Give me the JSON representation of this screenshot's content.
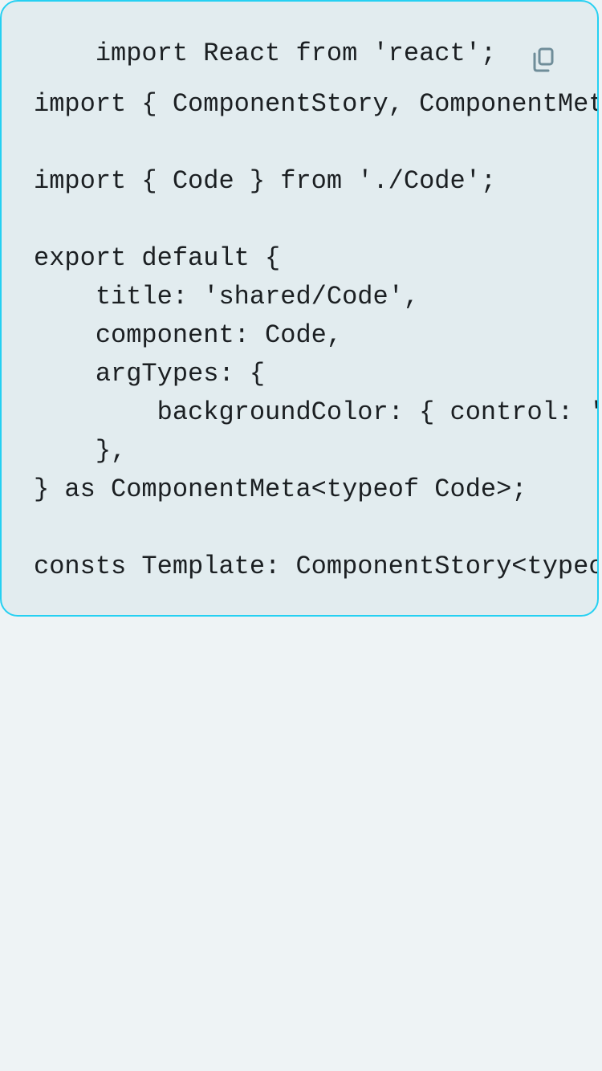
{
  "code_card": {
    "copy_icon": "copy-icon",
    "border_color": "#25d0f2",
    "background_color": "#e2ecef",
    "lines": [
      "    import React from 'react';",
      "import { ComponentStory, ComponentMeta } from '@storybook/react';",
      "",
      "import { Code } from './Code';",
      "",
      "export default {",
      "    title: 'shared/Code',",
      "    component: Code,",
      "    argTypes: {",
      "        backgroundColor: { control: 'color' },",
      "    },",
      "} as ComponentMeta<typeof Code>;",
      "",
      "consts Template: ComponentStory<typeof Code> = (args) => <Code {...args} />;"
    ]
  }
}
